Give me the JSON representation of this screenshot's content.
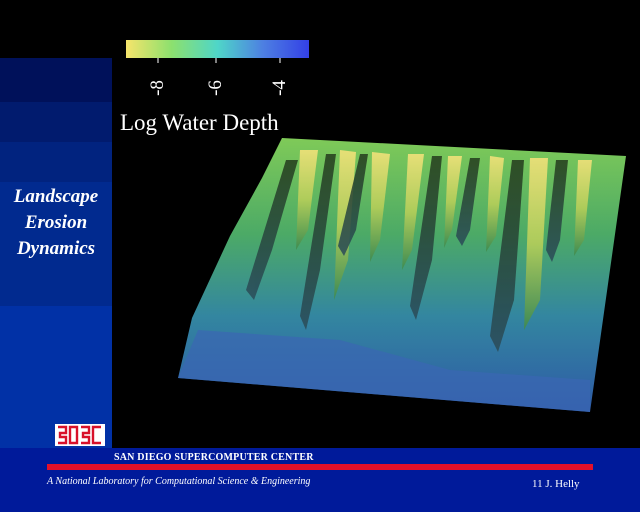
{
  "title": {
    "lines": [
      "Landscape",
      "Erosion",
      "Dynamics"
    ]
  },
  "legend": {
    "title": "Log Water Depth",
    "tick_labels": [
      "-8",
      "-6",
      "-4"
    ],
    "colors": [
      "#f6e46b",
      "#8ce06e",
      "#4fd6c8",
      "#4d7fe2",
      "#3340e6"
    ]
  },
  "footer": {
    "center_name": "SAN DIEGO SUPERCOMPUTER CENTER",
    "tagline": "A National Laboratory for Computational Science & Engineering",
    "credit": "11 J. Helly"
  },
  "colors": {
    "footer_band": "#001a9a",
    "rule": "#e4102a",
    "terrain_high": "#9bd05a",
    "terrain_low": "#2e5aa6"
  }
}
